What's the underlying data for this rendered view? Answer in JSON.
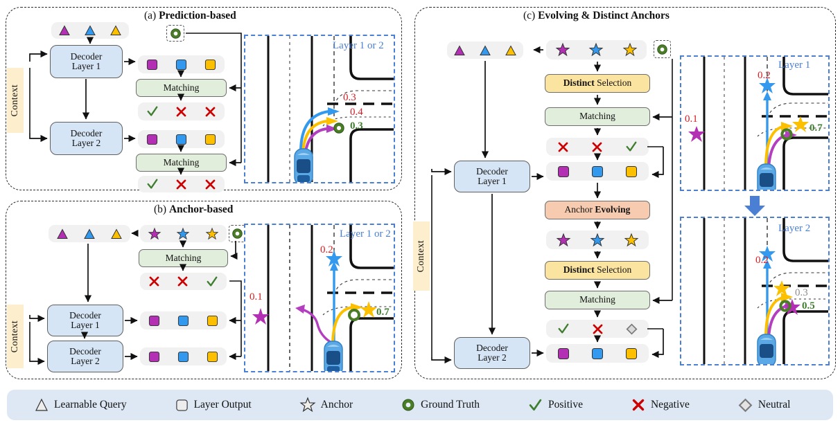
{
  "figure": {
    "panels": [
      {
        "id": "a",
        "title_prefix": "(a) ",
        "title": "Prediction-based"
      },
      {
        "id": "b",
        "title_prefix": "(b) ",
        "title": "Anchor-based"
      },
      {
        "id": "c",
        "title_prefix": "(c) ",
        "title": "Evolving & Distinct Anchors"
      }
    ]
  },
  "labels": {
    "context": "Context",
    "decoder_layer_1": "Decoder\nLayer 1",
    "decoder_layer_2": "Decoder\nLayer 2",
    "decoder_1_line1": "Decoder",
    "decoder_1_line2": "Layer 1",
    "decoder_2_line1": "Decoder",
    "decoder_2_line2": "Layer 2",
    "matching": "Matching",
    "distinct_bold": "Distinct",
    "distinct_rest": " Selection",
    "anchor_evolving_rest": "Anchor ",
    "anchor_evolving_bold": "Evolving"
  },
  "panel_a": {
    "title_prefix": "(a) ",
    "title": "Prediction-based",
    "queries": [
      "purple",
      "blue",
      "yellow"
    ],
    "outputs_row1": [
      "purple",
      "blue",
      "yellow"
    ],
    "outputs_row2": [
      "purple",
      "blue",
      "yellow"
    ],
    "matching_1": "Matching",
    "matching_2": "Matching",
    "results_row1": [
      "positive",
      "negative",
      "negative"
    ],
    "results_row2": [
      "positive",
      "negative",
      "negative"
    ],
    "scene": {
      "label": "Layer 1 or 2",
      "scores": [
        {
          "text": "0.3",
          "color": "red"
        },
        {
          "text": "0.4",
          "color": "red"
        },
        {
          "text": "0.3",
          "color": "green"
        }
      ]
    }
  },
  "panel_b": {
    "title_prefix": "(b) ",
    "title": "Anchor-based",
    "queries": [
      "purple",
      "blue",
      "yellow"
    ],
    "anchors": [
      "purple",
      "blue",
      "yellow"
    ],
    "matching": "Matching",
    "results": [
      "negative",
      "negative",
      "positive"
    ],
    "outputs_row1": [
      "purple",
      "blue",
      "yellow"
    ],
    "outputs_row2": [
      "purple",
      "blue",
      "yellow"
    ],
    "scene": {
      "label": "Layer 1 or 2",
      "scores": [
        {
          "text": "0.2",
          "color": "red"
        },
        {
          "text": "0.1",
          "color": "red"
        },
        {
          "text": "0.7",
          "color": "green"
        }
      ]
    }
  },
  "panel_c": {
    "title_prefix": "(c) ",
    "title": "Evolving & Distinct Anchors",
    "queries": [
      "purple",
      "blue",
      "yellow"
    ],
    "anchors_top": [
      "purple",
      "blue",
      "yellow"
    ],
    "anchors_mid": [
      "purple",
      "blue",
      "yellow"
    ],
    "distinct_selection_1": "Distinct Selection",
    "matching_1": "Matching",
    "results_1": [
      "negative",
      "negative",
      "positive"
    ],
    "outputs_1": [
      "purple",
      "blue",
      "yellow"
    ],
    "anchor_evolving": "Anchor Evolving",
    "distinct_selection_2": "Distinct Selection",
    "matching_2": "Matching",
    "results_2": [
      "positive",
      "negative",
      "neutral"
    ],
    "outputs_2": [
      "purple",
      "blue",
      "yellow"
    ],
    "scene_layer1": {
      "label": "Layer 1",
      "scores": [
        {
          "text": "0.2",
          "color": "red"
        },
        {
          "text": "0.1",
          "color": "red"
        },
        {
          "text": "0.7",
          "color": "green"
        }
      ]
    },
    "scene_layer2": {
      "label": "Layer 2",
      "scores": [
        {
          "text": "0.2",
          "color": "red"
        },
        {
          "text": "0.3",
          "color": "grey"
        },
        {
          "text": "0.5",
          "color": "green"
        }
      ]
    }
  },
  "legend": {
    "items": [
      {
        "icon": "triangle-icon",
        "label": "Learnable Query"
      },
      {
        "icon": "square-icon",
        "label": "Layer Output"
      },
      {
        "icon": "star-icon",
        "label": "Anchor"
      },
      {
        "icon": "donut-icon",
        "label": "Ground Truth"
      },
      {
        "icon": "check-icon",
        "label": "Positive"
      },
      {
        "icon": "cross-icon",
        "label": "Negative"
      },
      {
        "icon": "diamond-icon",
        "label": "Neutral"
      }
    ]
  },
  "colors": {
    "purple": "#b32fb3",
    "blue": "#3399ee",
    "yellow": "#fcc000",
    "green": "#3f7d2f",
    "red": "#d81b20",
    "grey": "#8d8d8d",
    "scene_border": "#4a7fd4",
    "decoder_fill": "#d6e5f5",
    "matching_fill": "#e2eedc",
    "distinct_fill": "#fbe3a0",
    "evolving_fill": "#f6cbb0",
    "context_fill": "#fdefcd",
    "legend_fill": "#dde8f4",
    "strip_fill": "#f1f1f1"
  }
}
